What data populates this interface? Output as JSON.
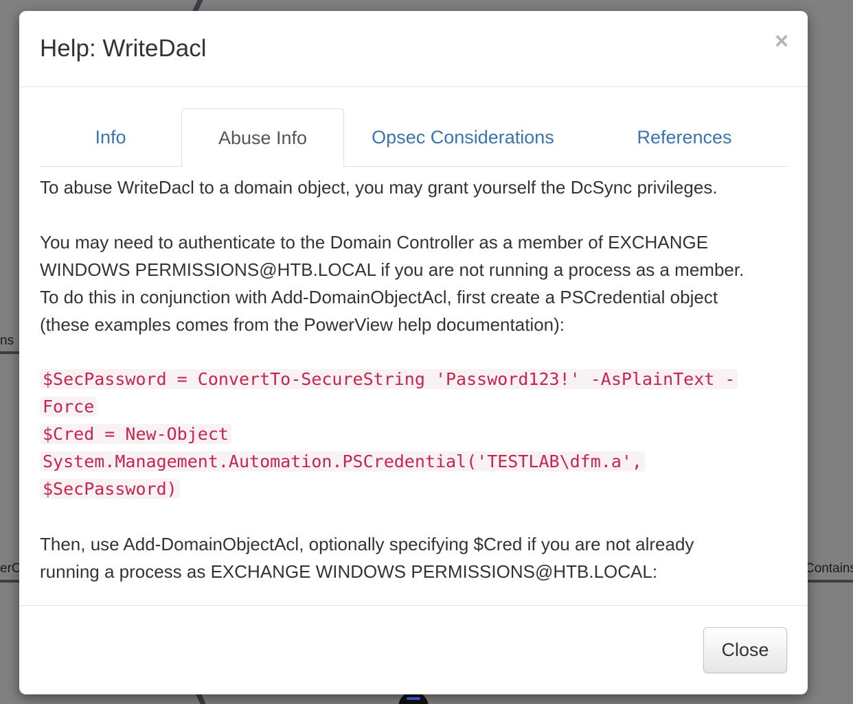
{
  "background": {
    "label_left_1": "ns",
    "label_left_2": "erC",
    "label_right": "Contains"
  },
  "modal": {
    "title": "Help: WriteDacl",
    "close_icon": "×",
    "tabs": [
      {
        "label": "Info",
        "active": false
      },
      {
        "label": "Abuse Info",
        "active": true
      },
      {
        "label": "Opsec Considerations",
        "active": false
      },
      {
        "label": "References",
        "active": false
      }
    ],
    "body": {
      "paragraph_1": "To abuse WriteDacl to a domain object, you may grant yourself the DcSync privileges.",
      "paragraph_2_lines": [
        "You may need to authenticate to the Domain Controller as a member of EXCHANGE",
        "WINDOWS PERMISSIONS@HTB.LOCAL if you are not running a process as a member.",
        "To do this in conjunction with Add-DomainObjectAcl, first create a PSCredential object",
        "(these examples comes from the PowerView help documentation):"
      ],
      "code_lines": [
        "$SecPassword = ConvertTo-SecureString 'Password123!' -AsPlainText -",
        "Force",
        "$Cred = New-Object",
        "System.Management.Automation.PSCredential('TESTLAB\\dfm.a',",
        "$SecPassword)"
      ],
      "paragraph_3_lines": [
        "Then, use Add-DomainObjectAcl, optionally specifying $Cred if you are not already",
        "running a process as EXCHANGE WINDOWS PERMISSIONS@HTB.LOCAL:"
      ]
    },
    "footer": {
      "close_label": "Close"
    }
  },
  "colors": {
    "overlay": "#808080",
    "tab_link": "#3a74ad",
    "code_text": "#c7254e",
    "code_bg": "#f9f2f4"
  }
}
